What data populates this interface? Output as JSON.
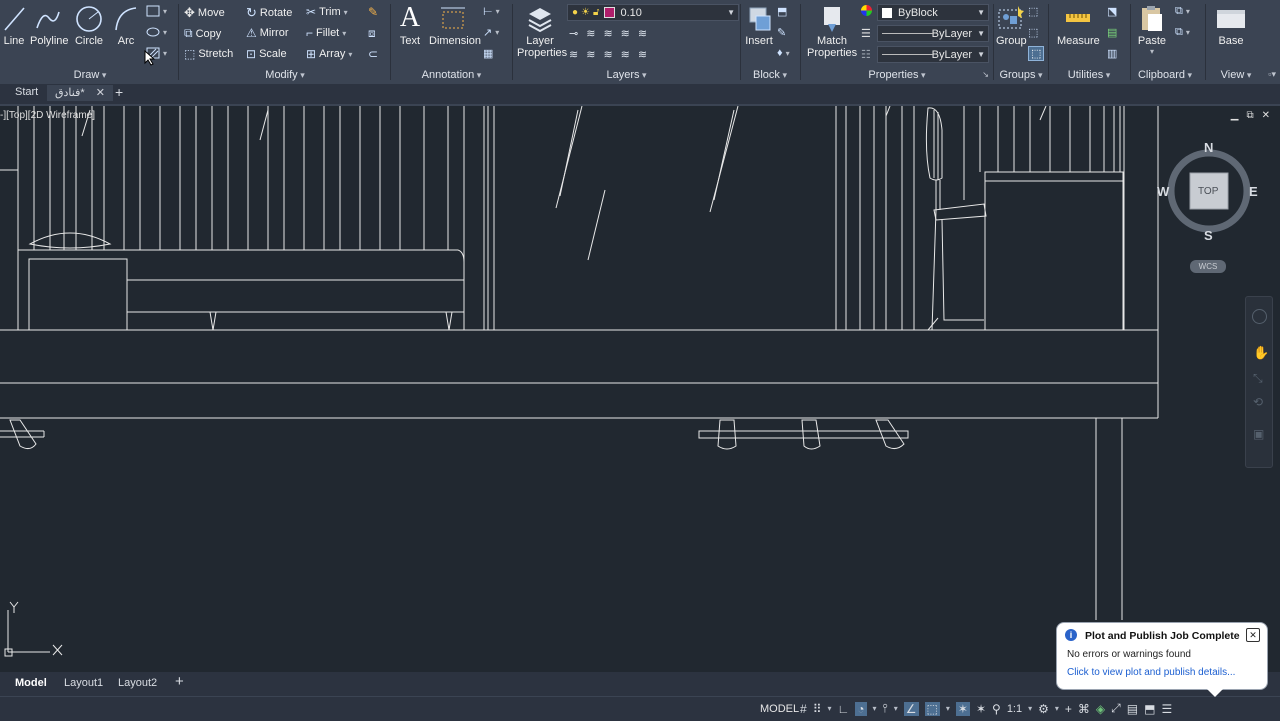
{
  "ribbon": {
    "draw": {
      "title": "Draw",
      "line": "Line",
      "polyline": "Polyline",
      "circle": "Circle",
      "arc": "Arc"
    },
    "modify": {
      "title": "Modify",
      "move": "Move",
      "rotate": "Rotate",
      "trim": "Trim",
      "copy": "Copy",
      "mirror": "Mirror",
      "fillet": "Fillet",
      "stretch": "Stretch",
      "scale": "Scale",
      "array": "Array"
    },
    "annotation": {
      "title": "Annotation",
      "text": "Text",
      "dimension": "Dimension"
    },
    "layers": {
      "title": "Layers",
      "layer_properties_1": "Layer",
      "layer_properties_2": "Properties",
      "current_layer": "0.10"
    },
    "block": {
      "title": "Block",
      "insert": "Insert"
    },
    "properties": {
      "title": "Properties",
      "match_1": "Match",
      "match_2": "Properties",
      "color": "ByBlock",
      "linetype": "ByLayer",
      "lineweight": "ByLayer"
    },
    "groups": {
      "title": "Groups",
      "group": "Group"
    },
    "utilities": {
      "title": "Utilities",
      "measure": "Measure"
    },
    "clipboard": {
      "title": "Clipboard",
      "paste": "Paste"
    },
    "view": {
      "title": "View",
      "base": "Base"
    }
  },
  "tabs": {
    "start": "Start",
    "drawing": "فنادق*",
    "add": "+"
  },
  "viewport": {
    "label": "-][Top][2D Wireframe]"
  },
  "viewcube": {
    "north": "N",
    "south": "S",
    "east": "E",
    "west": "W",
    "face": "TOP",
    "ucs": "WCS"
  },
  "ucs_icon": {
    "x": "X",
    "y": "Y"
  },
  "layouts": {
    "model": "Model",
    "layout1": "Layout1",
    "layout2": "Layout2",
    "add": "+"
  },
  "status": {
    "mode": "MODEL",
    "scale": "1:1"
  },
  "notification": {
    "title": "Plot and Publish Job Complete",
    "body": "No errors or warnings found",
    "link": "Click to view plot and publish details..."
  },
  "colors": {
    "background": "#212830",
    "ribbon": "#3b4453",
    "layer_color": "#b01e6b",
    "link": "#1c5fd1"
  }
}
